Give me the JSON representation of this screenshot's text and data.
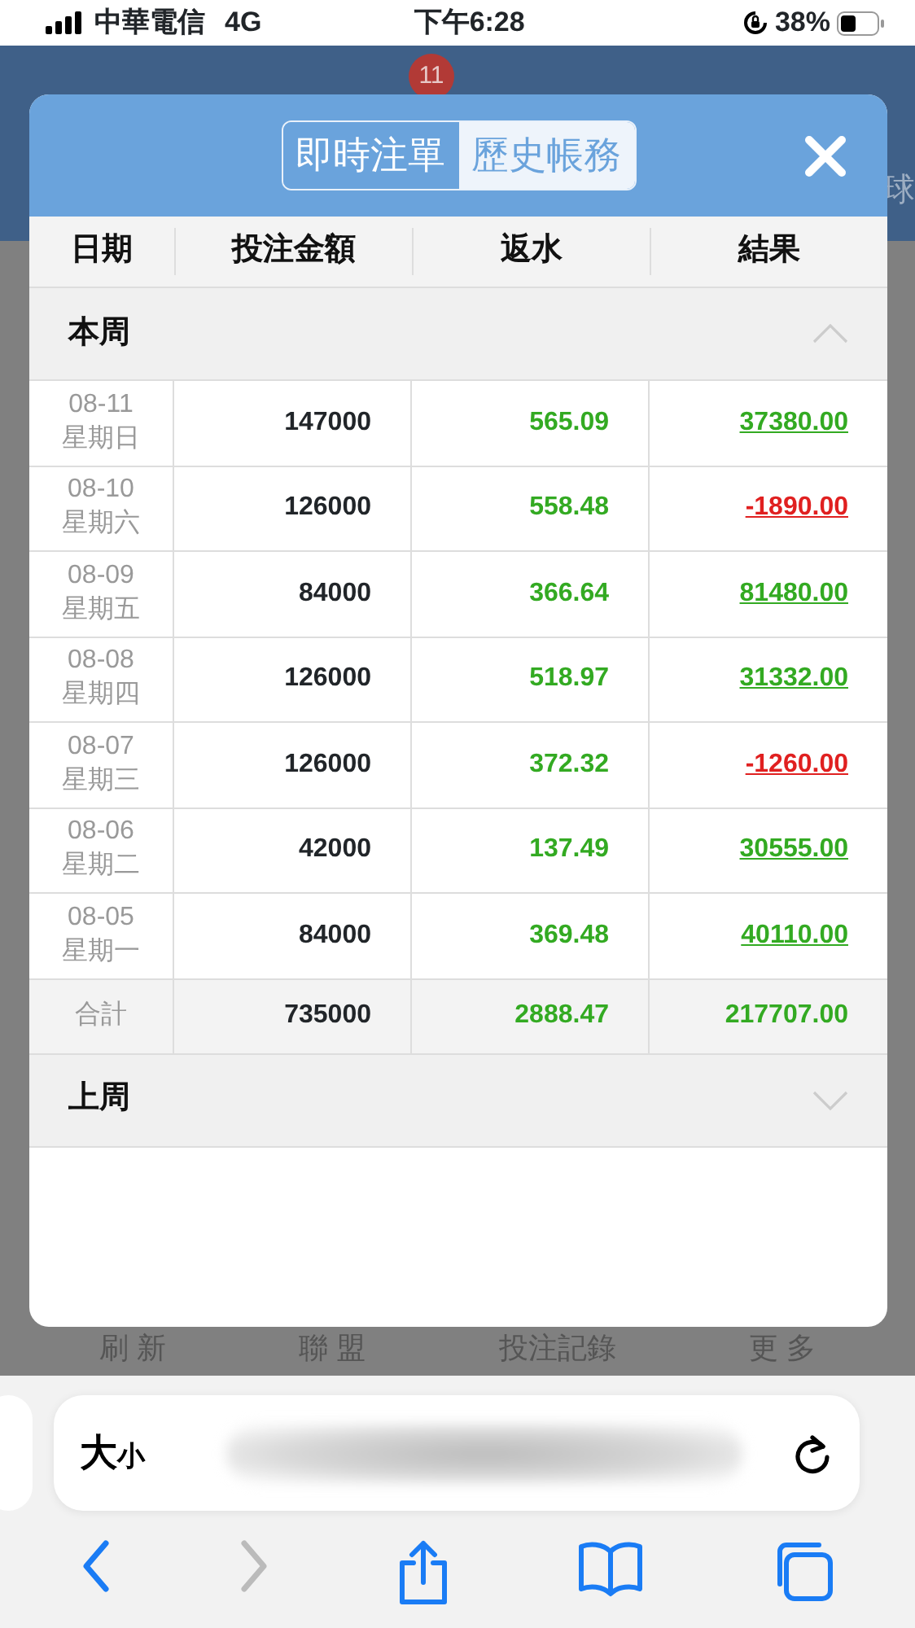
{
  "status_bar": {
    "carrier": "中華電信",
    "network": "4G",
    "time": "下午6:28",
    "battery": "38%"
  },
  "background": {
    "badge": "11",
    "edge_text": "球",
    "bottom_nav": [
      "刷 新",
      "聯 盟",
      "投注記錄",
      "更 多"
    ]
  },
  "modal": {
    "tabs": [
      {
        "label": "即時注單",
        "selected": false
      },
      {
        "label": "歷史帳務",
        "selected": true
      }
    ],
    "columns": [
      "日期",
      "投注金額",
      "返水",
      "結果"
    ],
    "sections": [
      {
        "title": "本周",
        "expanded": true,
        "rows": [
          {
            "date": "08-11",
            "weekday": "星期日",
            "amount": "147000",
            "rebate": "565.09",
            "result": "37380.00",
            "negative": false
          },
          {
            "date": "08-10",
            "weekday": "星期六",
            "amount": "126000",
            "rebate": "558.48",
            "result": "-1890.00",
            "negative": true
          },
          {
            "date": "08-09",
            "weekday": "星期五",
            "amount": "84000",
            "rebate": "366.64",
            "result": "81480.00",
            "negative": false
          },
          {
            "date": "08-08",
            "weekday": "星期四",
            "amount": "126000",
            "rebate": "518.97",
            "result": "31332.00",
            "negative": false
          },
          {
            "date": "08-07",
            "weekday": "星期三",
            "amount": "126000",
            "rebate": "372.32",
            "result": "-1260.00",
            "negative": true
          },
          {
            "date": "08-06",
            "weekday": "星期二",
            "amount": "42000",
            "rebate": "137.49",
            "result": "30555.00",
            "negative": false
          },
          {
            "date": "08-05",
            "weekday": "星期一",
            "amount": "84000",
            "rebate": "369.48",
            "result": "40110.00",
            "negative": false
          }
        ],
        "total": {
          "label": "合計",
          "amount": "735000",
          "rebate": "2888.47",
          "result": "217707.00"
        }
      },
      {
        "title": "上周",
        "expanded": false
      }
    ]
  },
  "browser": {
    "text_size": "大小"
  }
}
